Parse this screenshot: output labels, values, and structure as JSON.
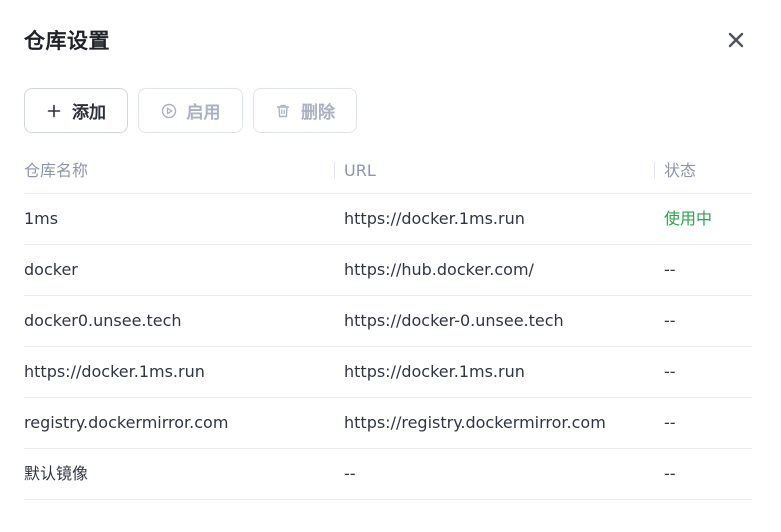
{
  "dialog": {
    "title": "仓库设置"
  },
  "toolbar": {
    "add_label": "添加",
    "enable_label": "启用",
    "delete_label": "删除"
  },
  "table": {
    "headers": [
      "仓库名称",
      "URL",
      "状态"
    ],
    "rows": [
      {
        "name": "1ms",
        "url": "https://docker.1ms.run",
        "status": "使用中"
      },
      {
        "name": "docker",
        "url": "https://hub.docker.com/",
        "status": "--"
      },
      {
        "name": "docker0.unsee.tech",
        "url": "https://docker-0.unsee.tech",
        "status": "--"
      },
      {
        "name": "https://docker.1ms.run",
        "url": "https://docker.1ms.run",
        "status": "--"
      },
      {
        "name": "registry.dockermirror.com",
        "url": "https://registry.dockermirror.com",
        "status": "--"
      },
      {
        "name": "默认镜像",
        "url": "--",
        "status": "--"
      }
    ]
  },
  "icons": {
    "close": "close-icon",
    "add": "plus-icon",
    "enable": "play-circle-icon",
    "delete": "trash-icon"
  },
  "colors": {
    "active_status": "#2aa54b",
    "disabled_text": "#a9b1c2",
    "header_text": "#8d96a7"
  }
}
